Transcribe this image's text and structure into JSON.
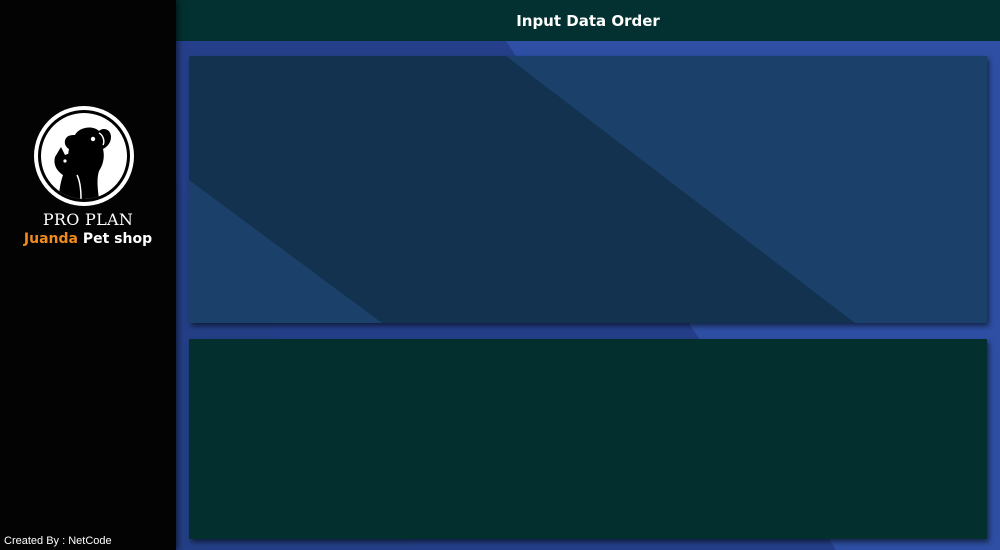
{
  "app": {
    "brand_line1": "PRO PLAN",
    "brand_accent": "Juanda",
    "brand_rest": " Pet shop",
    "footer_credit": "Created By : NetCode"
  },
  "header": {
    "title": "Input Data Order"
  },
  "colors": {
    "sidebar_bg": "#030303",
    "header_bg": "#033131",
    "main_bg": "#2c4a9a",
    "panel_top_bg": "#1b416b",
    "panel_bottom_bg": "#042f2f",
    "accent_orange": "#f08a1c"
  },
  "icons": {
    "logo": "pet-logo-icon"
  }
}
